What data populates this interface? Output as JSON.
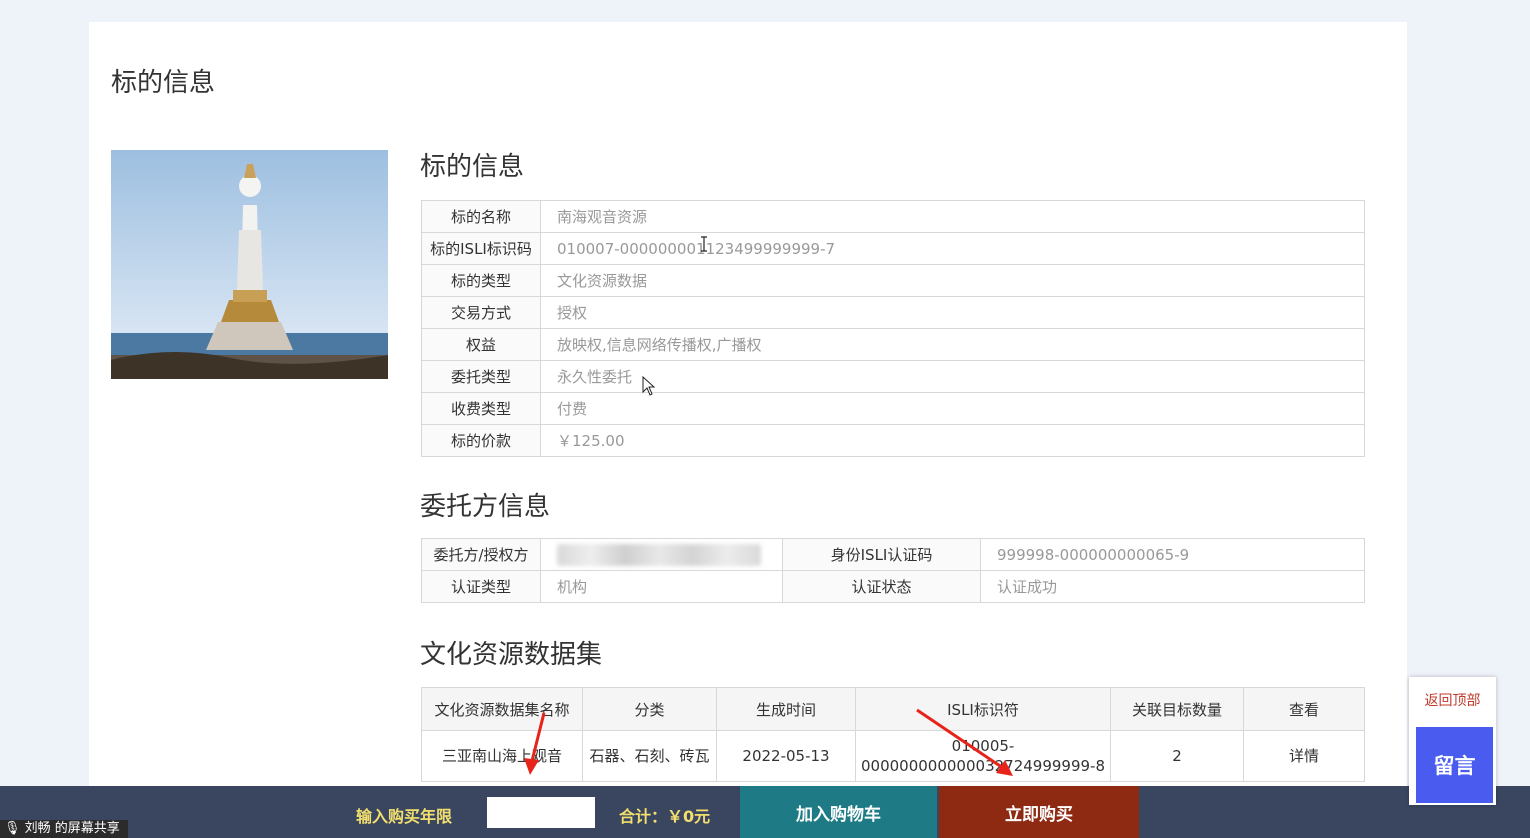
{
  "page": {
    "title": "标的信息"
  },
  "asset_section": {
    "heading": "标的信息",
    "rows": [
      {
        "label": "标的名称",
        "value": "南海观音资源"
      },
      {
        "label": "标的ISLI标识码",
        "value": "010007-000000001123499999999-7"
      },
      {
        "label": "标的类型",
        "value": "文化资源数据"
      },
      {
        "label": "交易方式",
        "value": "授权"
      },
      {
        "label": "权益",
        "value": "放映权,信息网络传播权,广播权"
      },
      {
        "label": "委托类型",
        "value": "永久性委托"
      },
      {
        "label": "收费类型",
        "value": "付费"
      },
      {
        "label": "标的价款",
        "value": "￥125.00"
      }
    ]
  },
  "entrust_section": {
    "heading": "委托方信息",
    "party_label": "委托方/授权方",
    "party_value": "",
    "isli_label": "身份ISLI认证码",
    "isli_value": "999998-000000000065-9",
    "cert_type_label": "认证类型",
    "cert_type_value": "机构",
    "cert_status_label": "认证状态",
    "cert_status_value": "认证成功"
  },
  "dataset_section": {
    "heading": "文化资源数据集",
    "columns": [
      "文化资源数据集名称",
      "分类",
      "生成时间",
      "ISLI标识符",
      "关联目标数量",
      "查看"
    ],
    "rows": [
      {
        "name": "三亚南山海上观音",
        "category": "石器、石刻、砖瓦",
        "created": "2022-05-13",
        "isli_line1": "010005-",
        "isli_line2": "000000000000032724999999-8",
        "count": "2",
        "view": "详情"
      }
    ]
  },
  "purchase_bar": {
    "years_label": "输入购买年限",
    "years_value": "",
    "total": "合计：￥0元",
    "cart_button": "加入购物车",
    "buy_button": "立即购买"
  },
  "screen_share": {
    "label": "刘畅 的屏幕共享"
  },
  "side_widget": {
    "back_top": "返回顶部",
    "message": "留言"
  },
  "colors": {
    "buy_button": "#8e2a12",
    "cart_button": "#1e7b86",
    "bottom_bar": "#3a4660",
    "message_button": "#4a5cf0"
  }
}
